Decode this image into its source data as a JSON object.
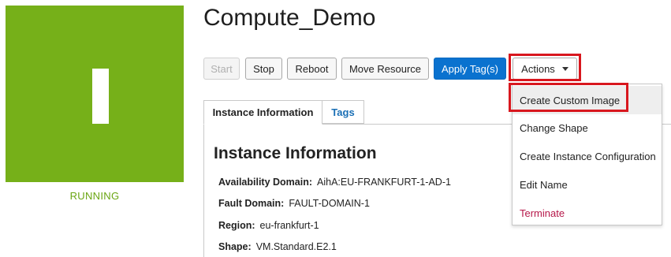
{
  "instance": {
    "name": "Compute_Demo",
    "status": "RUNNING",
    "status_color": "#76b019",
    "status_icon": "instance-running-icon"
  },
  "toolbar": {
    "start": "Start",
    "stop": "Stop",
    "reboot": "Reboot",
    "move_resource": "Move Resource",
    "apply_tags": "Apply Tag(s)",
    "actions": "Actions",
    "primary_color": "#0a72cf",
    "highlight_color": "#d8171e"
  },
  "tabs": [
    {
      "label": "Instance Information",
      "active": true
    },
    {
      "label": "Tags",
      "active": false
    }
  ],
  "info": {
    "title": "Instance Information",
    "rows": [
      {
        "key": "Availability Domain:",
        "value": "AihA:EU-FRANKFURT-1-AD-1"
      },
      {
        "key": "Fault Domain:",
        "value": "FAULT-DOMAIN-1"
      },
      {
        "key": "Region:",
        "value": "eu-frankfurt-1"
      },
      {
        "key": "Shape:",
        "value": "VM.Standard.E2.1"
      }
    ]
  },
  "actions_menu": {
    "items": [
      {
        "label": "Create Custom Image"
      },
      {
        "label": "Change Shape"
      },
      {
        "label": "Create Instance Configuration"
      },
      {
        "label": "Edit Name"
      },
      {
        "label": "Terminate"
      }
    ]
  }
}
